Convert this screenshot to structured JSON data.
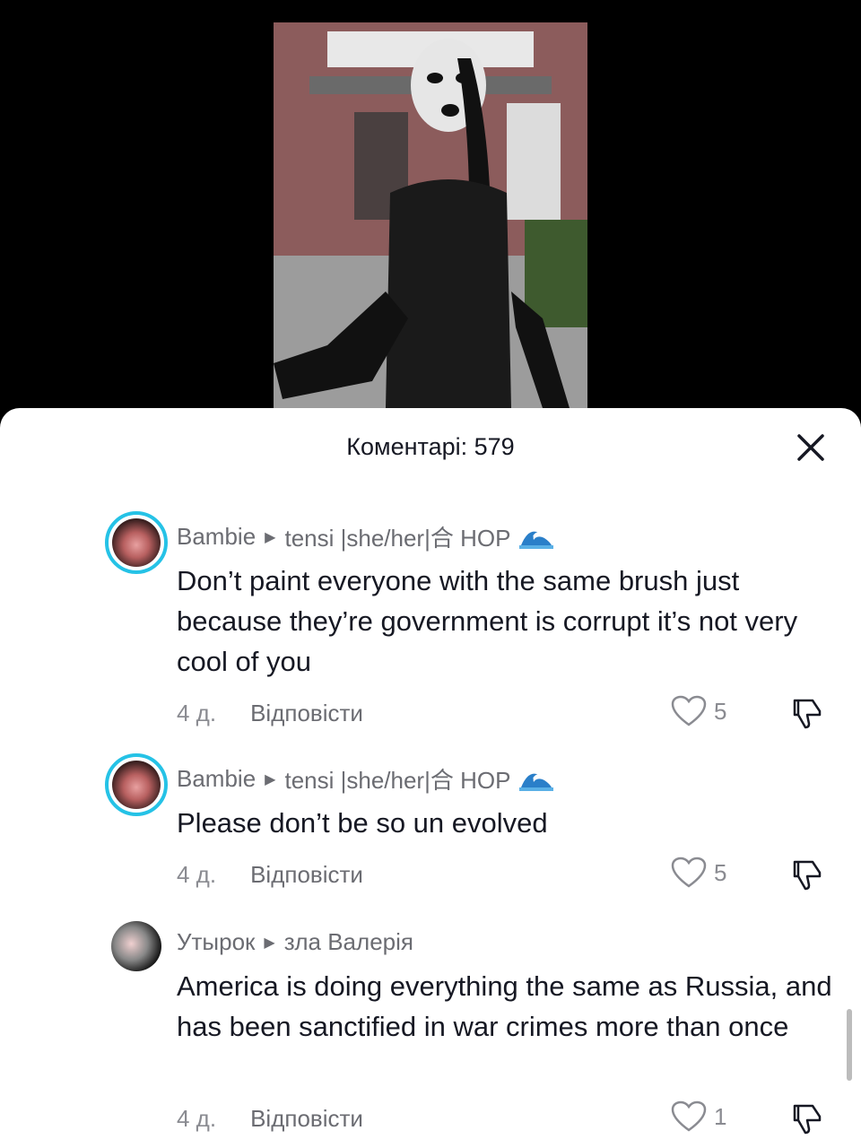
{
  "header": {
    "title": "Коментарі: 579"
  },
  "comments": [
    {
      "user": "Bambie",
      "reply_to": "tensi |she/her|合 HOP",
      "text": "Don’t paint everyone with the same brush just because they’re government is corrupt it’s not very cool of you",
      "time": "4 д.",
      "reply_label": "Відповісти",
      "likes": "5"
    },
    {
      "user": "Bambie",
      "reply_to": "tensi |she/her|合 HOP",
      "text": "Please don’t be so un evolved",
      "time": "4 д.",
      "reply_label": "Відповісти",
      "likes": "5"
    },
    {
      "user": "Утырок",
      "reply_to": "зла Валерія",
      "text": "America is doing everything the same as Russia, and has been sanctified in war crimes more than once",
      "time": "4 д.",
      "reply_label": "Відповісти",
      "likes": "1"
    }
  ],
  "colors": {
    "avatar_ring": "#25c2e6",
    "text": "#161823",
    "secondary": "#8a8b91"
  }
}
